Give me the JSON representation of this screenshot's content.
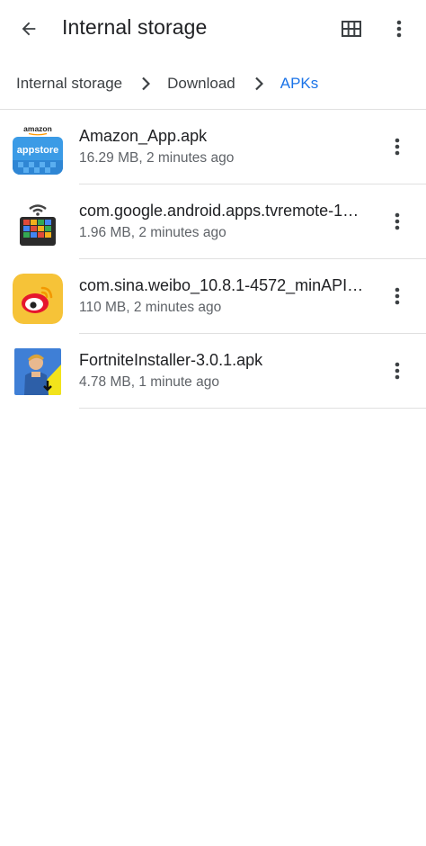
{
  "appbar": {
    "title": "Internal storage",
    "back_icon": "arrow-back-icon",
    "grid_icon": "grid-view-icon",
    "more_icon": "more-vert-icon"
  },
  "breadcrumb": {
    "items": [
      "Internal storage",
      "Download",
      "APKs"
    ],
    "separator_icon": "chevron-right-icon",
    "active_color": "#1a73e8"
  },
  "files": [
    {
      "name": "Amazon_App.apk",
      "meta": "16.29 MB, 2 minutes ago",
      "icon": "amazon-appstore-icon",
      "icon_top_text": "amazon",
      "icon_main_text": "appstore"
    },
    {
      "name": "com.google.android.apps.tvremote-1…",
      "meta": "1.96 MB, 2 minutes ago",
      "icon": "tv-remote-icon"
    },
    {
      "name": "com.sina.weibo_10.8.1-4572_minAPI…",
      "meta": "110 MB, 2 minutes ago",
      "icon": "weibo-icon"
    },
    {
      "name": "FortniteInstaller-3.0.1.apk",
      "meta": "4.78 MB, 1 minute ago",
      "icon": "fortnite-installer-icon"
    }
  ],
  "row_more_icon": "more-vert-icon"
}
